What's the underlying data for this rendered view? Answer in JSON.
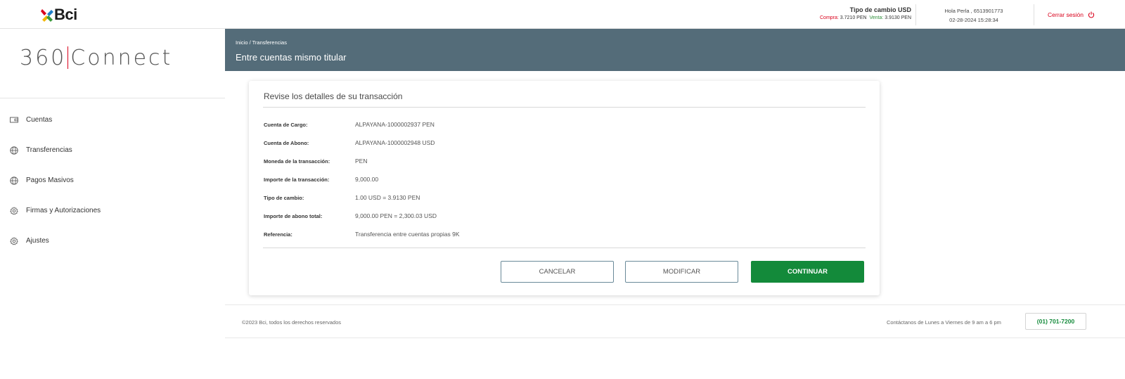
{
  "brand": {
    "logo_text": "Bci",
    "product": "360",
    "product_suffix": "Connect"
  },
  "header": {
    "fx_title": "Tipo de cambio USD",
    "fx_buy_label": "Compra:",
    "fx_buy_value": "3.7210 PEN",
    "fx_sell_label": "Venta:",
    "fx_sell_value": "3.9130 PEN",
    "user_greeting": "Hola Perla , 6513901773",
    "datetime": "02-28-2024 15:28:34",
    "logout_label": "Cerrar sesión"
  },
  "sidebar": {
    "items": [
      {
        "label": "Cuentas",
        "icon": "wallet-icon"
      },
      {
        "label": "Transferencias",
        "icon": "globe-icon"
      },
      {
        "label": "Pagos Masivos",
        "icon": "globe-icon"
      },
      {
        "label": "Firmas y Autorizaciones",
        "icon": "gear-icon"
      },
      {
        "label": "Ajustes",
        "icon": "gear-icon"
      }
    ]
  },
  "page": {
    "breadcrumb": "Inicio / Transferencias",
    "title": "Entre cuentas mismo titular"
  },
  "review": {
    "title": "Revise los detalles de su transacción",
    "rows": [
      {
        "label": "Cuenta de Cargo:",
        "value": "ALPAYANA-1000002937 PEN"
      },
      {
        "label": "Cuenta de Abono:",
        "value": "ALPAYANA-1000002948 USD"
      },
      {
        "label": "Moneda de la transacción:",
        "value": "PEN"
      },
      {
        "label": "Importe de la transacción:",
        "value": "9,000.00"
      },
      {
        "label": "Tipo de cambio:",
        "value": "1.00 USD = 3.9130 PEN"
      },
      {
        "label": "Importe de abono total:",
        "value": "9,000.00 PEN = 2,300.03 USD"
      },
      {
        "label": "Referencia:",
        "value": "Transferencia entre cuentas propias 9K"
      }
    ],
    "cancel_label": "CANCELAR",
    "modify_label": "MODIFICAR",
    "continue_label": "CONTINUAR"
  },
  "footer": {
    "copyright": "©2023 Bci, todos los derechos reservados",
    "contact": "Contáctanos de Lunes a Viernes de 9 am a 6 pm",
    "phone": "(01) 701-7200"
  },
  "colors": {
    "accent": "#d9001b",
    "band": "#546c79",
    "primary_button": "#138a3a"
  }
}
